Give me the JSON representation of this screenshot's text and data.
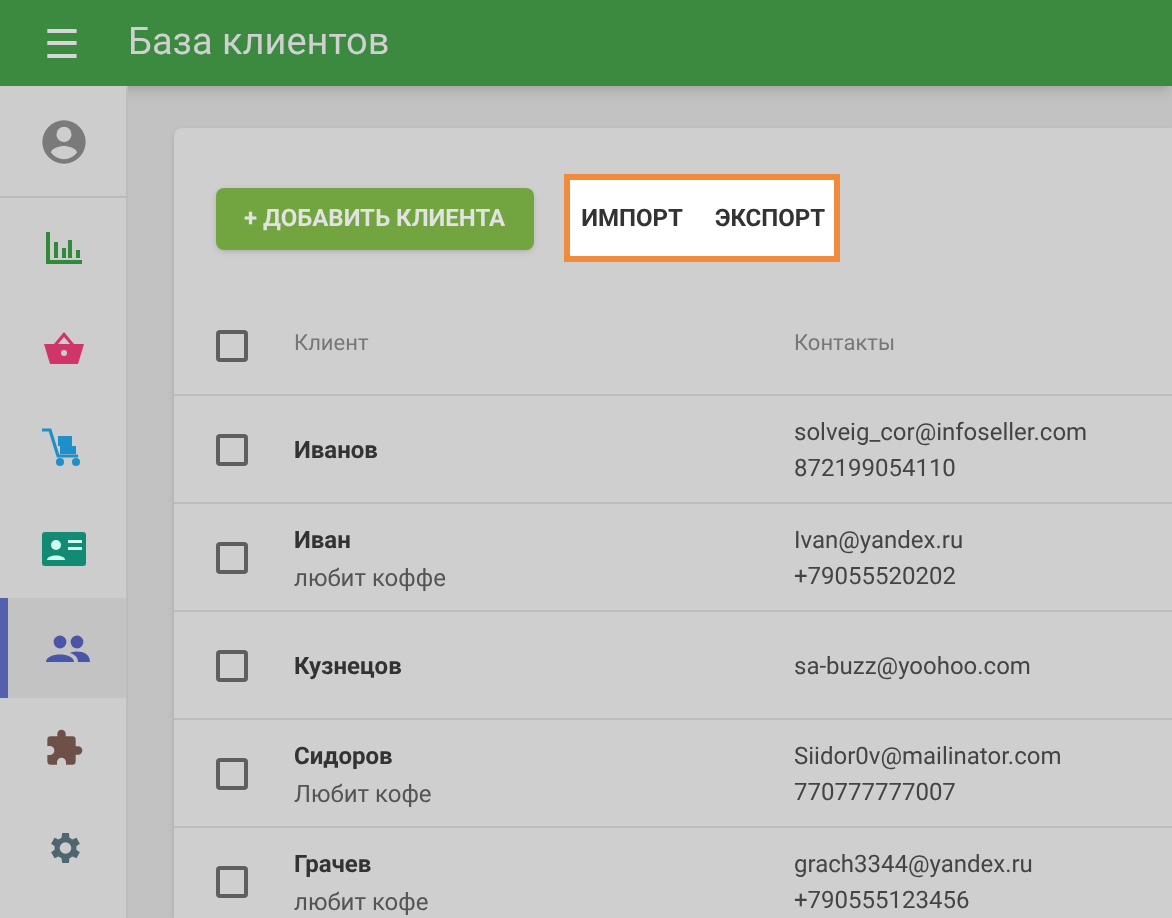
{
  "app_bar": {
    "menu_icon": "☰",
    "title": "База клиентов"
  },
  "sidebar": {
    "items": [
      {
        "kind": "profile",
        "selected": false
      },
      {
        "kind": "chart",
        "selected": false
      },
      {
        "kind": "basket",
        "selected": false
      },
      {
        "kind": "cart",
        "selected": false
      },
      {
        "kind": "card",
        "selected": false
      },
      {
        "kind": "people",
        "selected": true
      },
      {
        "kind": "puzzle",
        "selected": false
      },
      {
        "kind": "gear",
        "selected": false
      }
    ]
  },
  "toolbar": {
    "add_button": "+ ДОБАВИТЬ КЛИЕНТА",
    "highlighted_actions": [
      "ИМПОРТ",
      "ЭКСПОРТ"
    ]
  },
  "table": {
    "header_checked": false,
    "columns": [
      "Клиент",
      "Контакты"
    ],
    "rows": [
      {
        "checked": false,
        "name": "Иванов",
        "email": "solveig_cor@infoseller.com",
        "phone": "872199054110"
      },
      {
        "checked": false,
        "name": "Иван",
        "note": "любит коффе",
        "email": "Ivan@yandex.ru",
        "phone": "+79055520202"
      },
      {
        "checked": false,
        "name": "Кузнецов",
        "email": "sa-buzz@yoohoo.com"
      },
      {
        "checked": false,
        "name": "Сидоров",
        "note": "Любит кофе",
        "email": "Siidor0v@mailinator.com",
        "phone": "770777777007"
      },
      {
        "checked": false,
        "name": "Грачев",
        "note": "любит кофе",
        "email": "grach3344@yandex.ru",
        "phone": "+790555123456"
      }
    ]
  }
}
